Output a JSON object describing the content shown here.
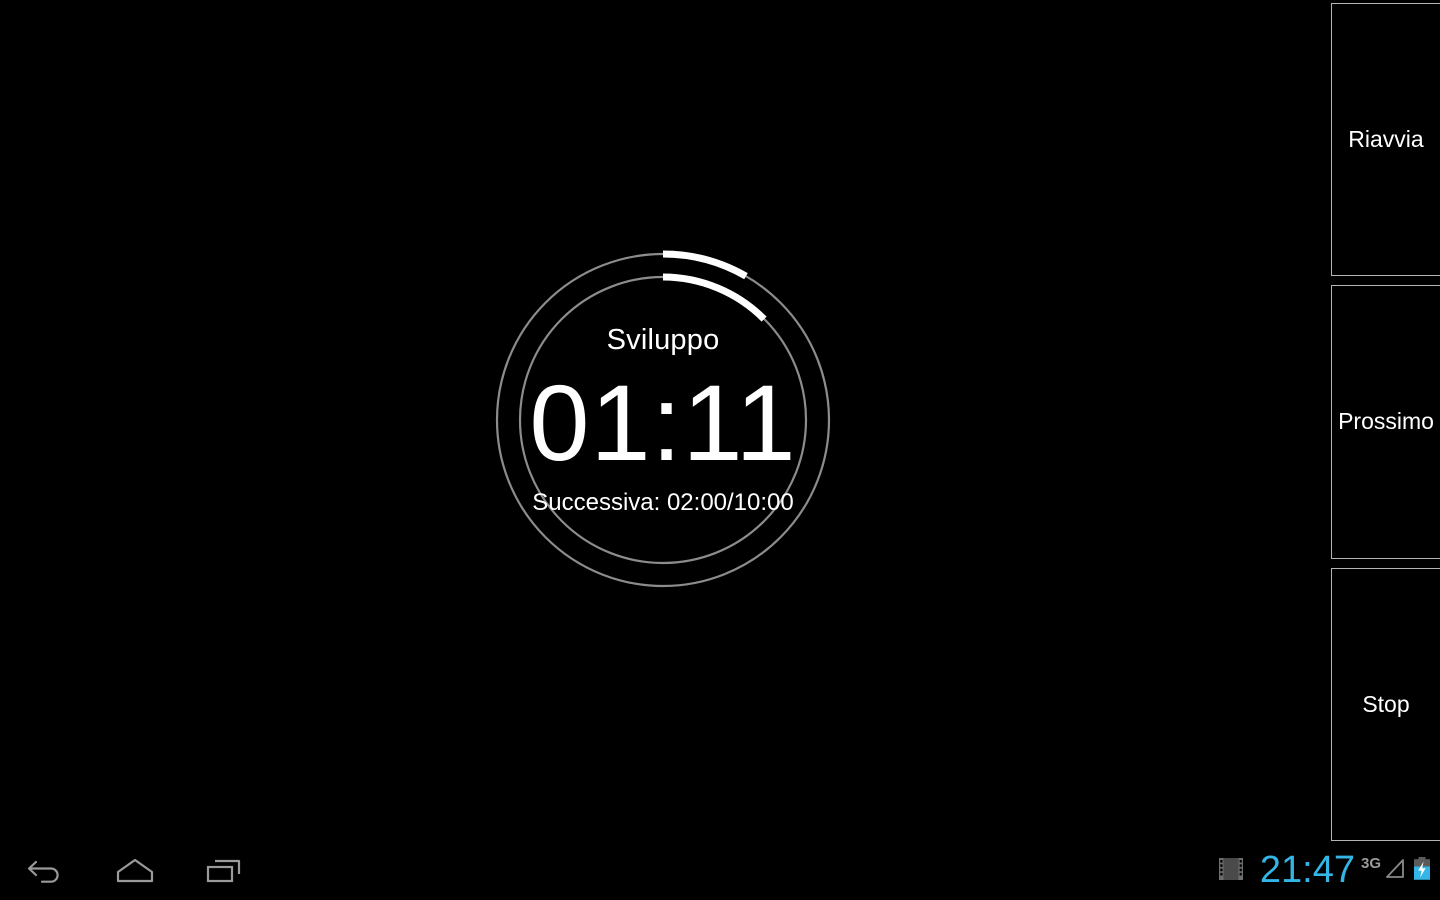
{
  "app": {
    "name": "interval-timer",
    "background_color": "#000000"
  },
  "timer": {
    "label": "Sviluppo",
    "remaining": "01:11",
    "next_line": "Successiva: 02:00/10:00",
    "next_prefix": "Successiva:",
    "next_interval": "02:00",
    "total_duration": "10:00",
    "ring_color": "#ffffff",
    "track_color": "#8c8c8c",
    "outer_progress_degrees": 30,
    "inner_progress_degrees": 45
  },
  "controls": {
    "buttons": [
      {
        "label": "Riavvia",
        "name": "restart-button"
      },
      {
        "label": "Prossimo",
        "name": "next-button"
      },
      {
        "label": "Stop",
        "name": "stop-button"
      }
    ]
  },
  "system_bar": {
    "nav": [
      {
        "label": "Back",
        "icon": "back-arrow-icon"
      },
      {
        "label": "Home",
        "icon": "home-icon"
      },
      {
        "label": "Recent apps",
        "icon": "recent-apps-icon"
      }
    ],
    "status": {
      "media_icon": "film-strip-icon",
      "clock": "21:47",
      "clock_color": "#33b5e5",
      "network_type": "3G",
      "signal_icon": "signal-triangle-icon",
      "battery_icon": "battery-charging-icon",
      "battery_color": "#33b5e5"
    }
  }
}
